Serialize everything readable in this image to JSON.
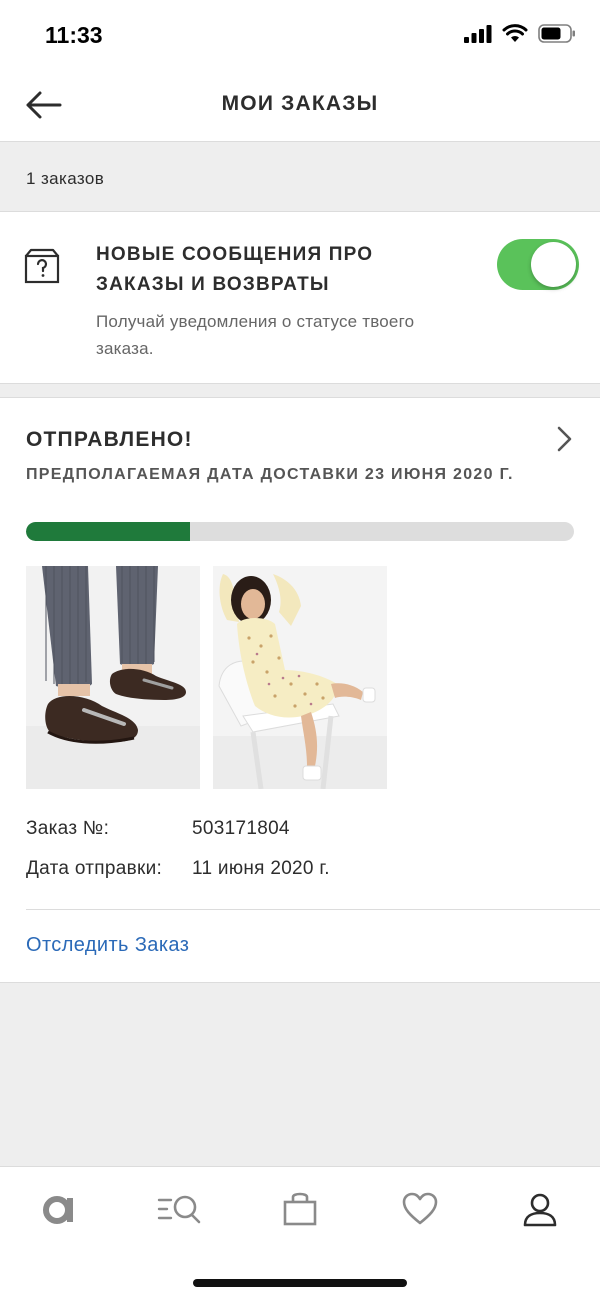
{
  "status_bar": {
    "time": "11:33"
  },
  "header": {
    "title": "МОИ ЗАКАЗЫ",
    "back_icon": "arrow-left-icon"
  },
  "orders_count": "1 заказов",
  "notifications": {
    "icon": "box-question-icon",
    "title": "НОВЫЕ СООБЩЕНИЯ ПРО ЗАКАЗЫ И ВОЗВРАТЫ",
    "description": "Получай уведомления о статусе твоего заказа.",
    "toggle_on": true,
    "toggle_color": "#5ac25a"
  },
  "order": {
    "status": "ОТПРАВЛЕНО!",
    "delivery_estimate": "ПРЕДПОЛАГАЕМАЯ ДАТА ДОСТАВКИ 23 ИЮНЯ 2020 Г.",
    "progress": 0.3,
    "progress_color": "#1f7a3b",
    "products": [
      {
        "name": "product-loafers-image"
      },
      {
        "name": "product-dress-image"
      }
    ],
    "order_number_label": "Заказ №:",
    "order_number": "503171804",
    "ship_date_label": "Дата отправки:",
    "ship_date": "11 июня 2020 г.",
    "track_link": "Отследить Заказ",
    "link_color": "#2b6ab8"
  },
  "tab_bar": {
    "items": [
      {
        "icon": "asos-logo-icon"
      },
      {
        "icon": "search-menu-icon"
      },
      {
        "icon": "bag-icon"
      },
      {
        "icon": "heart-icon"
      },
      {
        "icon": "account-icon",
        "active": true
      }
    ]
  }
}
